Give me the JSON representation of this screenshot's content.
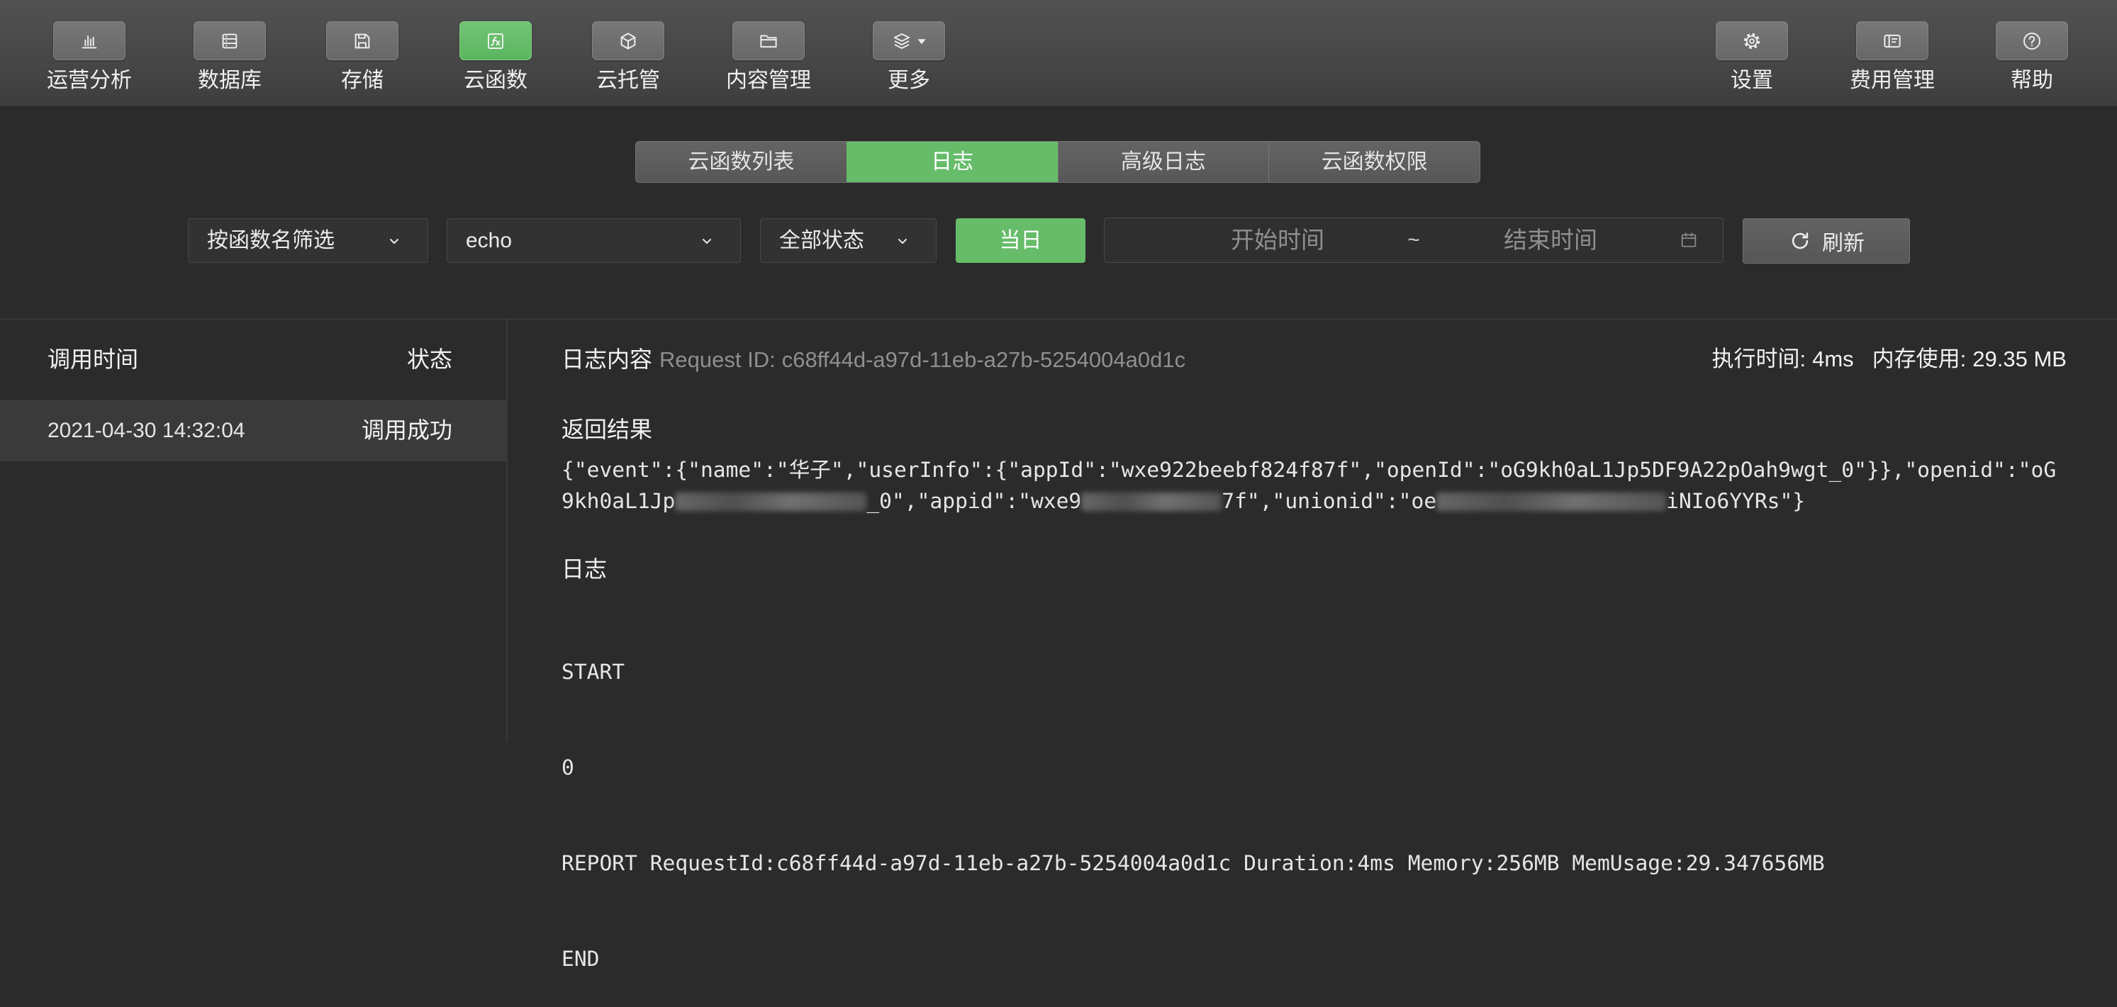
{
  "colors": {
    "accent": "#66bc69",
    "background": "#2b2b2b",
    "muted_text": "#8f8f8f"
  },
  "toolbar": {
    "left": [
      {
        "label": "运营分析",
        "icon": "bar-chart-icon"
      },
      {
        "label": "数据库",
        "icon": "database-icon"
      },
      {
        "label": "存储",
        "icon": "save-icon"
      },
      {
        "label": "云函数",
        "icon": "function-icon",
        "active": true
      },
      {
        "label": "云托管",
        "icon": "cube-icon"
      },
      {
        "label": "内容管理",
        "icon": "folder-icon"
      },
      {
        "label": "更多",
        "icon": "layers-icon"
      }
    ],
    "right": [
      {
        "label": "设置",
        "icon": "gear-icon"
      },
      {
        "label": "费用管理",
        "icon": "billing-icon"
      },
      {
        "label": "帮助",
        "icon": "help-icon"
      }
    ]
  },
  "tabs": [
    {
      "label": "云函数列表",
      "active": false
    },
    {
      "label": "日志",
      "active": true
    },
    {
      "label": "高级日志",
      "active": false
    },
    {
      "label": "云函数权限",
      "active": false
    }
  ],
  "filters": {
    "filter_mode": "按函数名筛选",
    "function_name": "echo",
    "status": "全部状态",
    "today_button": "当日",
    "date_range": {
      "start_placeholder": "开始时间",
      "separator": "~",
      "end_placeholder": "结束时间"
    },
    "refresh_button": "刷新"
  },
  "log_list": {
    "columns": {
      "time": "调用时间",
      "status": "状态"
    },
    "rows": [
      {
        "time": "2021-04-30 14:32:04",
        "status": "调用成功",
        "selected": true
      }
    ]
  },
  "log_detail": {
    "title": "日志内容",
    "request_id_label": "Request ID:",
    "request_id": "c68ff44d-a97d-11eb-a27b-5254004a0d1c",
    "exec_time_label": "执行时间:",
    "exec_time": "4ms",
    "memory_label": "内存使用:",
    "memory": "29.35 MB",
    "result_title": "返回结果",
    "result_line1": "{\"event\":{\"name\":\"华子\",\"userInfo\":{\"appId\":\"wxe922beebf824f87f\",\"openId\":\"oG9kh0aL1Jp5DF9A22pOah9wgt_0\"}},\"openid\":\"oG",
    "result_line2": [
      "9kh0aL1Jp",
      "_0\",\"appid\":\"wxe9",
      "7f\",\"unionid\":\"oe",
      "iNIo6YYRs\"}"
    ],
    "log_title": "日志",
    "log_lines": [
      "START",
      "0",
      "REPORT RequestId:c68ff44d-a97d-11eb-a27b-5254004a0d1c Duration:4ms Memory:256MB MemUsage:29.347656MB",
      "END"
    ]
  }
}
